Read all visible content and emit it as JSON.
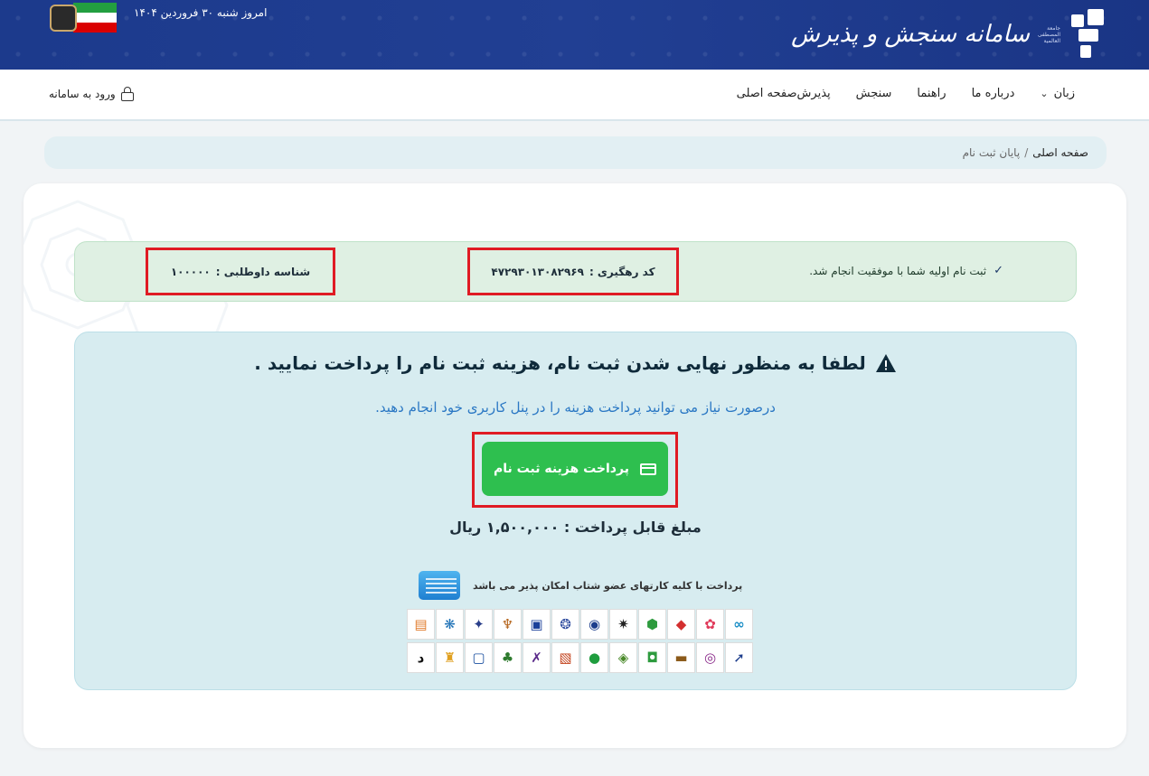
{
  "header": {
    "logo_title": "سامانه سنجش و پذیرش",
    "logo_subtitle": "جامعة المصطفی العالمیة",
    "date": "امروز شنبه ۳۰ فروردین ۱۴۰۴"
  },
  "nav": {
    "items": [
      "صفحه اصلی",
      "پذیرش",
      "سنجش",
      "راهنما",
      "درباره ما",
      "زبان"
    ],
    "login": "ورود به سامانه"
  },
  "breadcrumb": {
    "home": "صفحه اصلی",
    "separator": "/",
    "current": "پایان ثبت نام"
  },
  "success": {
    "message": "ثبت نام اولیه شما با موفقیت انجام شد.",
    "tracking_label": "کد رهگیری :",
    "tracking_value": "۴۷۲۹۳۰۱۳۰۸۲۹۶۹",
    "id_label": "شناسه داوطلبی :",
    "id_value": "۱۰۰۰۰۰"
  },
  "payment": {
    "title": "لطفا به منظور نهایی شدن ثبت نام، هزینه ثبت نام را پرداخت نمایید .",
    "subtitle": "درصورت نیاز می توانید پرداخت هزینه را در پنل کاربری خود انجام دهید.",
    "button_label": "پرداخت هزینه ثبت نام",
    "amount": "مبلغ قابل پرداخت : ۱,۵۰۰,۰۰۰ ریال",
    "shetab_note": "پرداخت با کلیه کارتهای عضو شتاب امکان پذیر می باشد"
  },
  "colors": {
    "header_bg": "#1f3c8f",
    "success_bg": "#dff0e3",
    "payment_bg": "#d7ecf0",
    "button": "#2ebf4f",
    "highlight": "#e01b24",
    "subtitle": "#2b78c4"
  },
  "banks": {
    "row1": [
      {
        "name": "bank-logo-1",
        "color": "#1a8ec6",
        "glyph": "∞"
      },
      {
        "name": "bank-logo-2",
        "color": "#e03a5a",
        "glyph": "✿"
      },
      {
        "name": "bank-logo-3",
        "color": "#d32f2f",
        "glyph": "◆"
      },
      {
        "name": "bank-logo-4",
        "color": "#2e9b3e",
        "glyph": "⬢"
      },
      {
        "name": "bank-logo-5",
        "color": "#222222",
        "glyph": "✷"
      },
      {
        "name": "bank-logo-6",
        "color": "#1c3d8c",
        "glyph": "◉"
      },
      {
        "name": "bank-logo-7",
        "color": "#2d4a9e",
        "glyph": "❂"
      },
      {
        "name": "bank-logo-8",
        "color": "#1a3f9a",
        "glyph": "▣"
      },
      {
        "name": "bank-logo-9",
        "color": "#b5651d",
        "glyph": "♆"
      },
      {
        "name": "bank-logo-10",
        "color": "#2a3f8a",
        "glyph": "✦"
      },
      {
        "name": "bank-logo-11",
        "color": "#1a6fb5",
        "glyph": "❋"
      },
      {
        "name": "bank-logo-12",
        "color": "#e07a2a",
        "glyph": "▤"
      }
    ],
    "row2": [
      {
        "name": "bank-logo-13",
        "color": "#1c3d8c",
        "glyph": "➚"
      },
      {
        "name": "bank-logo-14",
        "color": "#8a2a8a",
        "glyph": "◎"
      },
      {
        "name": "bank-logo-15",
        "color": "#8b5a1a",
        "glyph": "▬"
      },
      {
        "name": "bank-logo-16",
        "color": "#2e9b3e",
        "glyph": "◘"
      },
      {
        "name": "bank-logo-17",
        "color": "#4a8a2a",
        "glyph": "◈"
      },
      {
        "name": "bank-logo-18",
        "color": "#1f9d3e",
        "glyph": "●"
      },
      {
        "name": "bank-logo-19",
        "color": "#c2401a",
        "glyph": "▧"
      },
      {
        "name": "bank-logo-20",
        "color": "#5a2a8a",
        "glyph": "✗"
      },
      {
        "name": "bank-logo-21",
        "color": "#2e7b2e",
        "glyph": "♣"
      },
      {
        "name": "bank-logo-22",
        "color": "#1a4fa0",
        "glyph": "▢"
      },
      {
        "name": "bank-logo-23",
        "color": "#e0a020",
        "glyph": "♜"
      },
      {
        "name": "bank-logo-24",
        "color": "#111111",
        "glyph": "د"
      }
    ]
  }
}
